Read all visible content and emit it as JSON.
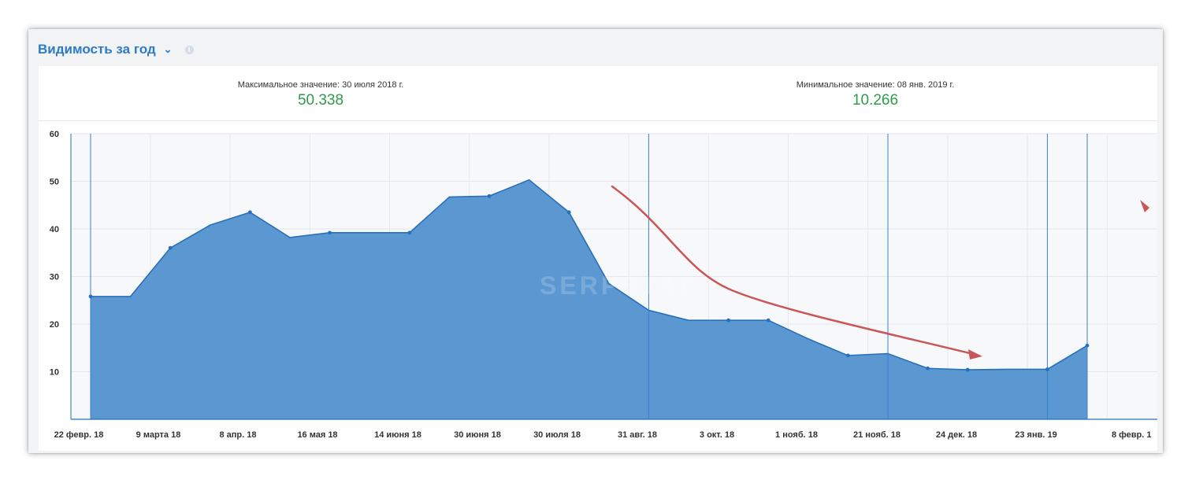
{
  "header": {
    "title": "Видимость за год",
    "chevron_icon": "chevron-down-icon",
    "info_icon": "info-icon",
    "accent": "#2d7bc8"
  },
  "stats": {
    "max": {
      "label": "Максимальное значение: 30 июля 2018 г.",
      "value": "50.338"
    },
    "min": {
      "label": "Минимальное значение: 08 янв. 2019 г.",
      "value": "10.266"
    },
    "value_color": "#2f9a49"
  },
  "watermark": "SERPSTAT",
  "chart_data": {
    "type": "area",
    "ylim": [
      0,
      60
    ],
    "yticks": [
      10,
      20,
      30,
      40,
      50,
      60
    ],
    "grid": true,
    "fill_color": "#5b98d2",
    "line_color": "#2a6fb9",
    "xtick_labels": [
      "22 февр. 18",
      "9 марта 18",
      "8 апр. 18",
      "16 мая 18",
      "14 июня 18",
      "30 июня 18",
      "30 июля 18",
      "31 авг. 18",
      "3 окт. 18",
      "1 нояб. 18",
      "21 нояб. 18",
      "24 дек. 18",
      "23 янв. 19",
      "8 февр. 1"
    ],
    "values": [
      25.8,
      25.8,
      36.0,
      40.8,
      43.5,
      38.2,
      39.2,
      39.2,
      39.2,
      46.7,
      46.9,
      50.3,
      43.5,
      28.5,
      22.9,
      20.8,
      20.8,
      20.8,
      16.9,
      13.4,
      13.8,
      10.7,
      10.4,
      10.5,
      10.5,
      15.5
    ],
    "marker_indices": [
      0,
      2,
      4,
      6,
      8,
      10,
      12,
      14,
      16,
      18,
      20,
      22,
      24,
      26,
      28,
      30,
      32,
      34,
      36,
      38,
      40,
      42,
      44,
      46,
      48,
      50
    ],
    "event_lines_x_index": [
      0,
      28,
      40,
      48,
      50
    ],
    "annotation_arrow_color": "#c9575a"
  }
}
